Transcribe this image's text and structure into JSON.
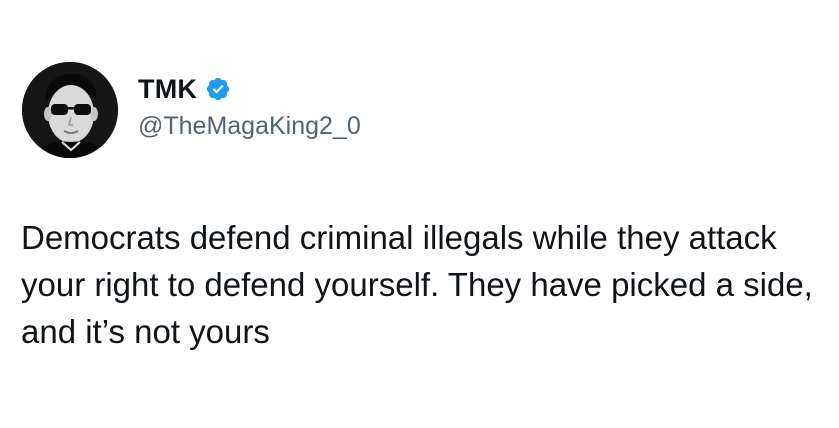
{
  "tweet": {
    "author": {
      "display_name": "TMK",
      "handle": "@TheMagaKing2_0",
      "verified": true
    },
    "text": "Democrats defend criminal illegals while they attack your right to defend yourself. They have picked a side, and it’s not yours"
  },
  "colors": {
    "text_primary": "#0f1419",
    "text_secondary": "#536471",
    "verified_blue": "#1d9bf0",
    "background": "#ffffff"
  },
  "icons": {
    "verified": "verified-badge-icon"
  }
}
